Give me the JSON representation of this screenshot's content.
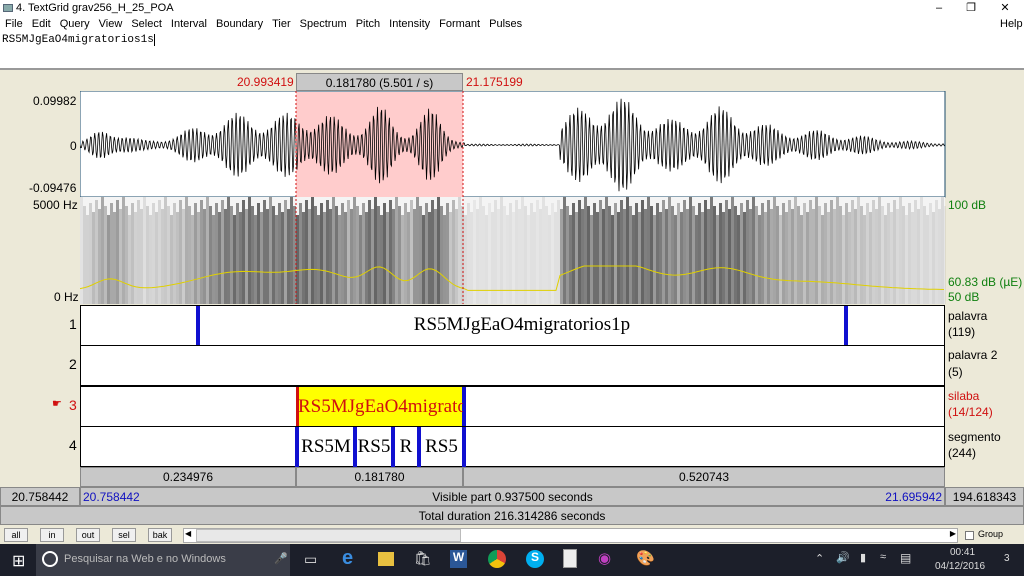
{
  "window": {
    "title": "4. TextGrid grav256_H_25_POA"
  },
  "menu": [
    "File",
    "Edit",
    "Query",
    "View",
    "Select",
    "Interval",
    "Boundary",
    "Tier",
    "Spectrum",
    "Pitch",
    "Intensity",
    "Formant",
    "Pulses"
  ],
  "menu_help": "Help",
  "text_field": "RS5MJgEaO4migratorios1s",
  "selection": {
    "start": "20.993419",
    "duration": "0.181780 (5.501 / s)",
    "end": "21.175199"
  },
  "waveform": {
    "max": "0.09982",
    "zero": "0",
    "min": "-0.09476"
  },
  "spectrogram": {
    "top": "5000 Hz",
    "bottom": "0 Hz",
    "db_top": "100 dB",
    "db_cursor": "60.83 dB (µE)",
    "db_bottom": "50 dB"
  },
  "tiers": [
    {
      "num": "1",
      "name": "palavra",
      "count": "(119)",
      "intervals": [
        "RS5MJgEaO4migratorios1p"
      ]
    },
    {
      "num": "2",
      "name": "palavra 2",
      "count": "(5)"
    },
    {
      "num": "3",
      "name": "silaba",
      "count": "(14/124)",
      "selected_text": "RS5MJgEaO4migrato"
    },
    {
      "num": "4",
      "name": "segmento",
      "count": "(244)",
      "intervals": [
        "RS5M",
        "RS5",
        "R",
        "RS5"
      ]
    }
  ],
  "durations": [
    "0.234976",
    "0.181780",
    "0.520743"
  ],
  "visible": {
    "left_outer": "20.758442",
    "left": "20.758442",
    "label": "Visible part 0.937500 seconds",
    "right": "21.695942",
    "right_outer": "194.618343"
  },
  "total": "Total duration 216.314286 seconds",
  "buttons": [
    "all",
    "in",
    "out",
    "sel",
    "bak"
  ],
  "group_label": "Group",
  "taskbar": {
    "search": "Pesquisar na Web e no Windows",
    "time": "00:41",
    "date": "04/12/2016",
    "notif": "3"
  },
  "colors": {
    "selection": "#ffcccc",
    "tier_highlight": "#ffff00",
    "boundary": "#1010d0",
    "red": "#d01010",
    "pitch": "#e0d000"
  }
}
